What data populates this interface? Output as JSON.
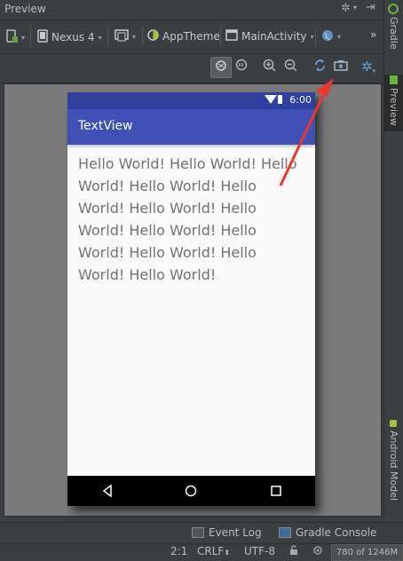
{
  "panel": {
    "title": "Preview"
  },
  "toolbar": {
    "device": "Nexus 4",
    "theme": "AppTheme",
    "activity": "MainActivity",
    "more": "»"
  },
  "device_screen": {
    "status_time": "6:00",
    "app_title": "TextView",
    "content_text": "Hello World! Hello World! Hello World! Hello World! Hello World! Hello World! Hello World! Hello World! Hello World! Hello World! Hello World! Hello World!"
  },
  "side_tabs": {
    "gradle": "Gradle",
    "preview": "Preview",
    "android_model": "Android Model"
  },
  "bottom_tabs": {
    "event_log": "Event Log",
    "gradle_console": "Gradle Console"
  },
  "status": {
    "position": "2:1",
    "line_separator": "CRLF",
    "encoding": "UTF-8",
    "memory": "780 of 1246M"
  },
  "colors": {
    "ide_background": "#3c3f41",
    "status_bar": "#303f9f",
    "app_bar": "#3f51b5",
    "annotation_arrow": "#e8382f"
  },
  "icons": {
    "title": [
      "gear-icon",
      "hide-icon"
    ],
    "toolbar": [
      "device-orientation-icon",
      "phone-icon",
      "screen-size-icon",
      "theme-icon",
      "activity-icon",
      "globe-icon"
    ],
    "preview_tools": [
      "zoom-to-fit-icon",
      "actual-size-icon",
      "zoom-in-icon",
      "zoom-out-icon",
      "refresh-icon",
      "screenshot-icon",
      "settings-icon"
    ]
  }
}
